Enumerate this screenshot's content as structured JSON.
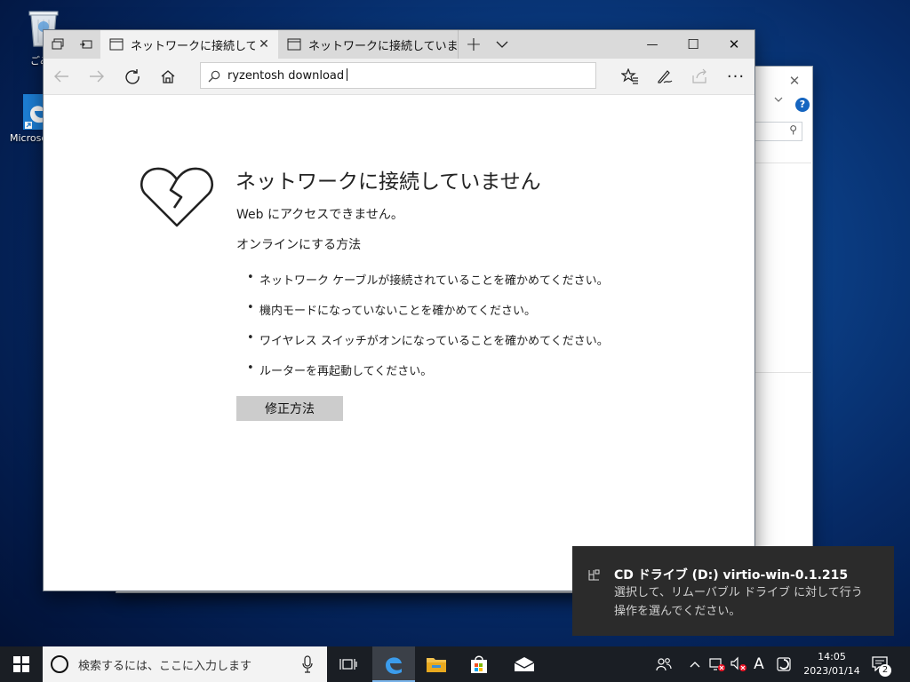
{
  "desktop": {
    "icons": [
      {
        "label": "ごみ箱",
        "icon": "recycle-bin-icon"
      },
      {
        "label": "Microsoft Edge",
        "icon": "edge-icon"
      }
    ]
  },
  "background_window": {
    "close_glyph": "✕",
    "help_glyph": "?"
  },
  "browser": {
    "tabs": [
      {
        "label": "ネットワークに接続していません",
        "active": true
      },
      {
        "label": "ネットワークに接続していません",
        "active": false
      }
    ],
    "new_tab_glyph": "+",
    "address": {
      "value": "ryzentosh download"
    },
    "window_controls": {
      "minimize": "—",
      "maximize": "☐",
      "close": "✕"
    }
  },
  "page": {
    "title": "ネットワークに接続していません",
    "subtitle": "Web にアクセスできません。",
    "howto_heading": "オンラインにする方法",
    "tips": [
      "ネットワーク ケーブルが接続されていることを確かめてください。",
      "機内モードになっていないことを確かめてください。",
      "ワイヤレス スイッチがオンになっていることを確かめてください。",
      "ルーターを再起動してください。"
    ],
    "fix_button": "修正方法"
  },
  "toast": {
    "title": "CD ドライブ (D:) virtio-win-0.1.215",
    "body": "選択して、リムーバブル ドライブ に対して行う操作を選んでください。"
  },
  "taskbar": {
    "search_placeholder": "検索するには、ここに入力します",
    "ime_indicator": "A",
    "time": "14:05",
    "date": "2023/01/14",
    "notification_count": "2"
  },
  "colors": {
    "desktop_bg": "#0b3f86",
    "taskbar_bg": "#1a1e24",
    "toast_bg": "#2b2b2b",
    "fix_button_bg": "#cccccc",
    "edge_blue": "#1d7fd6"
  }
}
